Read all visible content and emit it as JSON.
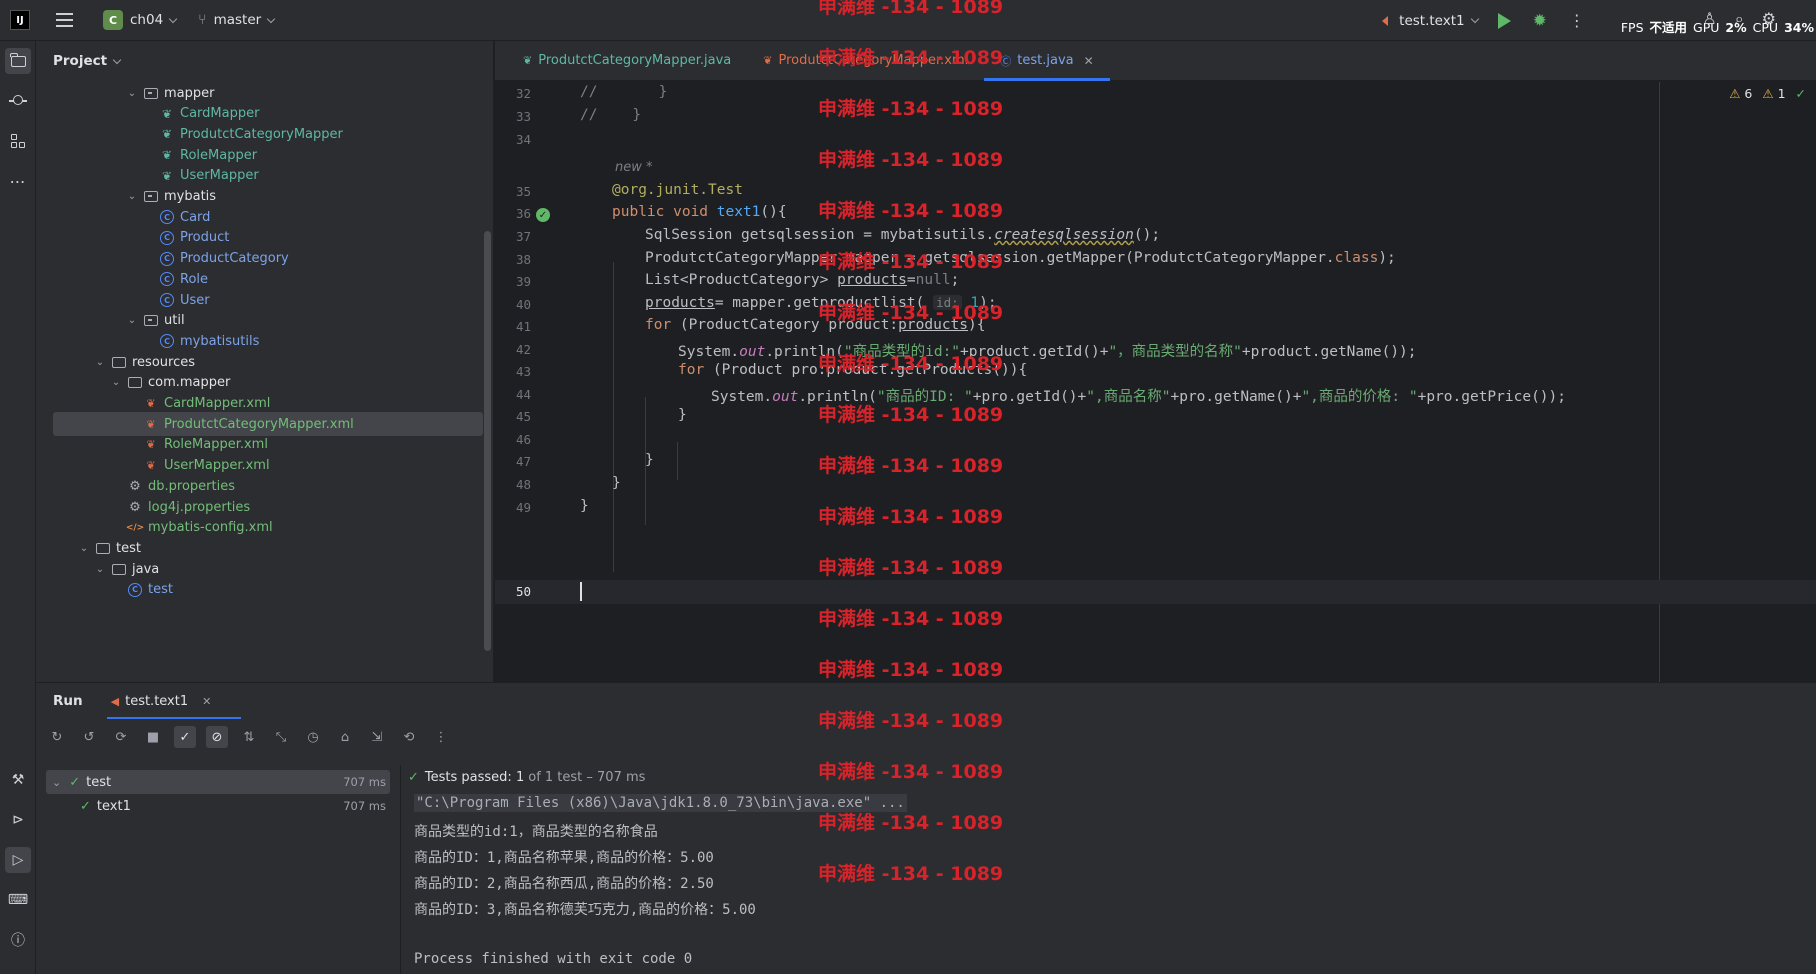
{
  "titlebar": {
    "project_badge": "C",
    "project_name": "ch04",
    "branch": "master",
    "run_config": "test.text1",
    "fps_label": "FPS",
    "fps_value": "不适用",
    "gpu_label": "GPU",
    "gpu_value": "2%",
    "cpu_label": "CPU",
    "cpu_value": "34%"
  },
  "project_panel": {
    "title": "Project",
    "tree": [
      {
        "label": "mapper",
        "type": "package",
        "depth": 4,
        "expanded": true
      },
      {
        "label": "CardMapper",
        "type": "interface",
        "depth": 5
      },
      {
        "label": "ProdutctCategoryMapper",
        "type": "interface",
        "depth": 5
      },
      {
        "label": "RoleMapper",
        "type": "interface",
        "depth": 5
      },
      {
        "label": "UserMapper",
        "type": "interface",
        "depth": 5
      },
      {
        "label": "mybatis",
        "type": "package",
        "depth": 4,
        "expanded": true
      },
      {
        "label": "Card",
        "type": "class",
        "depth": 5
      },
      {
        "label": "Product",
        "type": "class",
        "depth": 5
      },
      {
        "label": "ProductCategory",
        "type": "class",
        "depth": 5
      },
      {
        "label": "Role",
        "type": "class",
        "depth": 5
      },
      {
        "label": "User",
        "type": "class",
        "depth": 5
      },
      {
        "label": "util",
        "type": "package",
        "depth": 4,
        "expanded": true
      },
      {
        "label": "mybatisutils",
        "type": "class",
        "depth": 5
      },
      {
        "label": "resources",
        "type": "folder",
        "depth": 2,
        "expanded": true
      },
      {
        "label": "com.mapper",
        "type": "folder",
        "depth": 3,
        "expanded": true
      },
      {
        "label": "CardMapper.xml",
        "type": "xml",
        "depth": 4
      },
      {
        "label": "ProdutctCategoryMapper.xml",
        "type": "xml",
        "depth": 4,
        "selected": true
      },
      {
        "label": "RoleMapper.xml",
        "type": "xml",
        "depth": 4
      },
      {
        "label": "UserMapper.xml",
        "type": "xml",
        "depth": 4
      },
      {
        "label": "db.properties",
        "type": "props",
        "depth": 3
      },
      {
        "label": "log4j.properties",
        "type": "props",
        "depth": 3
      },
      {
        "label": "mybatis-config.xml",
        "type": "config",
        "depth": 3
      },
      {
        "label": "test",
        "type": "folder-plain",
        "depth": 1,
        "expanded": true
      },
      {
        "label": "java",
        "type": "folder-plain",
        "depth": 2,
        "expanded": true
      },
      {
        "label": "test",
        "type": "class",
        "depth": 3
      }
    ]
  },
  "editor": {
    "tabs": [
      {
        "label": "ProdutctCategoryMapper.java",
        "kind": "interface",
        "active": false
      },
      {
        "label": "ProdutctCategoryMapper.xml",
        "kind": "xml",
        "active": false
      },
      {
        "label": "test.java",
        "kind": "class",
        "active": true
      }
    ],
    "warnings": "6",
    "weak_warnings": "1",
    "line_numbers": [
      "32",
      "33",
      "34",
      "35",
      "36",
      "37",
      "38",
      "39",
      "40",
      "41",
      "42",
      "43",
      "44",
      "45",
      "46",
      "47",
      "48",
      "49",
      "50"
    ],
    "author_hint": "new *",
    "param_hint": "id:"
  },
  "run_panel": {
    "title": "Run",
    "tab_label": "test.text1",
    "tree": [
      {
        "label": "test",
        "time": "707 ms"
      },
      {
        "label": "text1",
        "time": "707 ms"
      }
    ],
    "passed_label": "Tests passed:",
    "passed_count": "1",
    "passed_detail": "of 1 test – 707 ms",
    "console": [
      "\"C:\\Program Files (x86)\\Java\\jdk1.8.0_73\\bin\\java.exe\" ...",
      "商品类型的id:1，商品类型的名称食品",
      "商品的ID：1,商品名称苹果,商品的价格：5.00",
      "商品的ID：2,商品名称西瓜,商品的价格：2.50",
      "商品的ID：3,商品名称德芙巧克力,商品的价格：5.00",
      "",
      "Process finished with exit code 0"
    ]
  },
  "watermark": "申满维 -134 - 1089",
  "colors": {
    "accent": "#3574f0",
    "success": "#5fb865",
    "watermark": "#d8232a"
  }
}
